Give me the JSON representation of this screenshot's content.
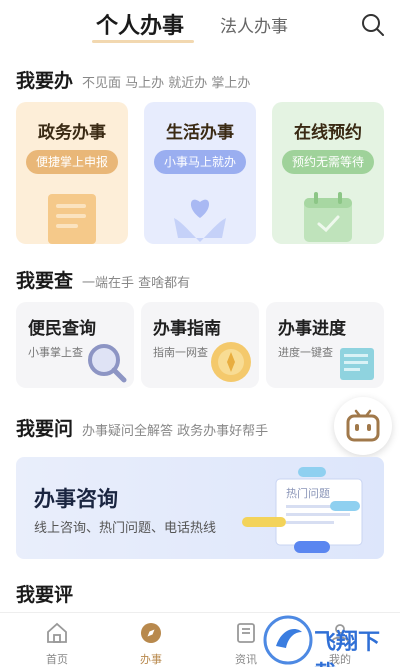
{
  "header": {
    "tab_active": "个人办事",
    "tab_other": "法人办事"
  },
  "sections": {
    "do": {
      "title": "我要办",
      "subtitle": "不见面 马上办 就近办 掌上办"
    },
    "check": {
      "title": "我要查",
      "subtitle": "一端在手 查啥都有"
    },
    "ask": {
      "title": "我要问",
      "subtitle": "办事疑问全解答 政务办事好帮手"
    },
    "rate": {
      "title": "我要评"
    }
  },
  "services": [
    {
      "title": "政务办事",
      "pill": "便捷掌上申报",
      "color": "#e9b778"
    },
    {
      "title": "生活办事",
      "pill": "小事马上就办",
      "color": "#9aaef0"
    },
    {
      "title": "在线预约",
      "pill": "预约无需等待",
      "color": "#9fd29a"
    }
  ],
  "queries": [
    {
      "title": "便民查询",
      "sub": "小事掌上查"
    },
    {
      "title": "办事指南",
      "sub": "指南一网查"
    },
    {
      "title": "办事进度",
      "sub": "进度一键查"
    }
  ],
  "consult": {
    "title": "办事咨询",
    "sub": "线上咨询、热门问题、电话热线",
    "card_label": "热门问题"
  },
  "nav": [
    {
      "label": "首页",
      "icon": "home-icon",
      "active": false
    },
    {
      "label": "办事",
      "icon": "compass-icon",
      "active": true
    },
    {
      "label": "资讯",
      "icon": "news-icon",
      "active": false
    },
    {
      "label": "我的",
      "icon": "user-icon",
      "active": false
    }
  ],
  "watermark": {
    "text": "飞翔下载"
  },
  "colors": {
    "accent": "#b8894d",
    "gold_card": "#fdeed8",
    "blue_card": "#e7ecfd",
    "green_card": "#e4f3e2"
  }
}
